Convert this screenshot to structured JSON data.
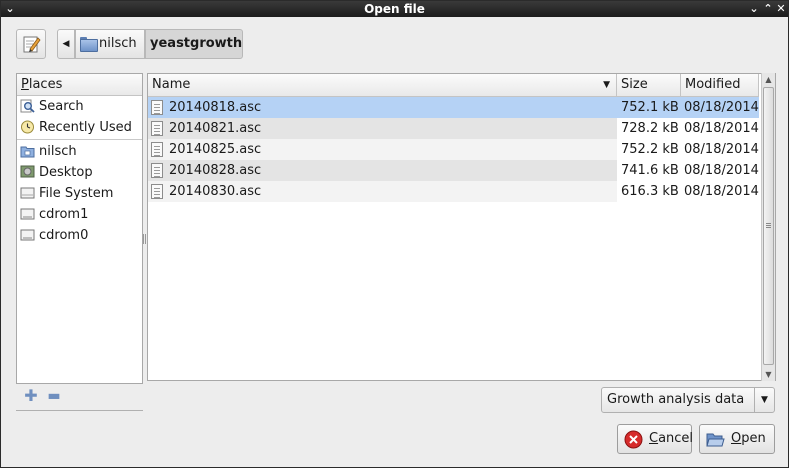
{
  "window": {
    "title": "Open file"
  },
  "toolbar": {
    "edit_location_icon": "pencil-edit-icon"
  },
  "pathbar": {
    "back_icon": "left-arrow-icon",
    "items": [
      {
        "label": "nilsch",
        "icon": "folder-icon"
      },
      {
        "label": "yeastgrowth"
      }
    ]
  },
  "places": {
    "header_first": "P",
    "header_rest": "laces",
    "items": [
      {
        "label": "Search",
        "icon": "search-icon"
      },
      {
        "label": "Recently Used",
        "icon": "clock-icon"
      },
      {
        "label": "nilsch",
        "icon": "home-folder-icon"
      },
      {
        "label": "Desktop",
        "icon": "desktop-icon"
      },
      {
        "label": "File System",
        "icon": "drive-icon"
      },
      {
        "label": "cdrom1",
        "icon": "cdrom-icon"
      },
      {
        "label": "cdrom0",
        "icon": "cdrom-icon"
      }
    ],
    "add_icon": "plus-icon",
    "remove_icon": "minus-icon"
  },
  "files": {
    "columns": {
      "name": "Name",
      "size": "Size",
      "modified": "Modified"
    },
    "rows": [
      {
        "name": "20140818.asc",
        "size": "752.1 kB",
        "modified": "08/18/2014",
        "selected": true
      },
      {
        "name": "20140821.asc",
        "size": "728.2 kB",
        "modified": "08/18/2014"
      },
      {
        "name": "20140825.asc",
        "size": "752.2 kB",
        "modified": "08/18/2014"
      },
      {
        "name": "20140828.asc",
        "size": "741.6 kB",
        "modified": "08/18/2014"
      },
      {
        "name": "20140830.asc",
        "size": "616.3 kB",
        "modified": "08/18/2014"
      }
    ]
  },
  "filter": {
    "selected": "Growth analysis data"
  },
  "buttons": {
    "cancel_first": "C",
    "cancel_rest": "ancel",
    "open_first": "O",
    "open_rest": "pen"
  },
  "colors": {
    "selection": "#b5d2f5",
    "row_alt": "#ececec",
    "accent": "#4a6ea8"
  }
}
